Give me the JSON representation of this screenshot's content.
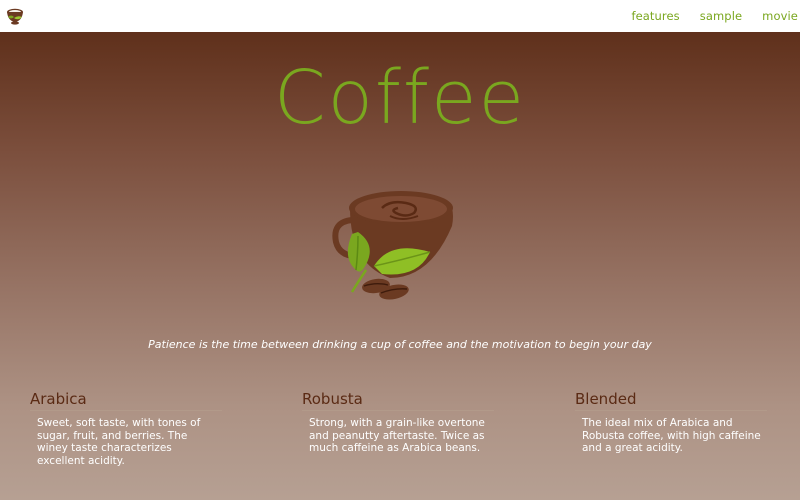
{
  "nav": {
    "logo_icon": "coffee-cup-logo-icon",
    "links": [
      "features",
      "sample",
      "movie"
    ]
  },
  "hero": {
    "title": "Coffee",
    "illustration_icon": "coffee-cup-with-leaves-icon",
    "quote": "Patience is the time between drinking a cup of coffee and the motivation to begin your day"
  },
  "features": [
    {
      "title": "Arabica",
      "description": "Sweet, soft taste, with tones of sugar, fruit, and berries. The winey taste characterizes excellent acidity."
    },
    {
      "title": "Robusta",
      "description": "Strong, with a grain-like overtone and peanutty aftertaste. Twice as much caffeine as Arabica beans."
    },
    {
      "title": "Blended",
      "description": "The ideal mix of Arabica and Robusta coffee, with high caffeine and a great acidity."
    }
  ],
  "colors": {
    "accent_green": "#7aa71f",
    "heading_brown": "#5a2a14",
    "gradient_top": "#5f301b",
    "gradient_bottom": "#b6a093"
  }
}
